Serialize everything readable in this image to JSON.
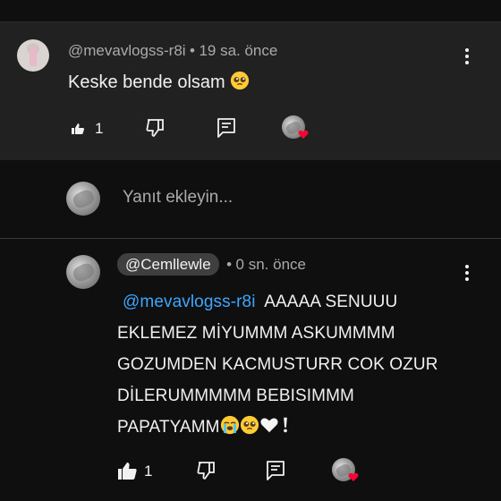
{
  "colors": {
    "background": "#0f0f0f",
    "card": "#212121",
    "mention": "#3ea6ff",
    "heart": "#ff0033"
  },
  "comment": {
    "author": "@mevavlogss-r8i",
    "separator": "•",
    "time": "19 sa. önce",
    "text": "Keske bende olsam",
    "text_emoji": "pleading-face-emoji",
    "like_count": "1"
  },
  "reply_box": {
    "placeholder": "Yanıt ekleyin..."
  },
  "reply": {
    "author": "@Cemllewle",
    "separator": "•",
    "time": "0 sn. önce",
    "mention": "@mevavlogss-r8i",
    "lines": [
      "AAAAA SENUUU",
      "EKLEMEZ MİYUMMM ASKUMMMM",
      "GOZUMDEN KACMUSTURR COK OZUR",
      "DİLERUMMMMM BEBISIMMM",
      "PAPATYAMM"
    ],
    "trailing_emojis": [
      "loudly-crying-face-emoji",
      "pleading-face-emoji",
      "white-heart-emoji",
      "exclamation-emoji"
    ],
    "like_count": "1"
  }
}
